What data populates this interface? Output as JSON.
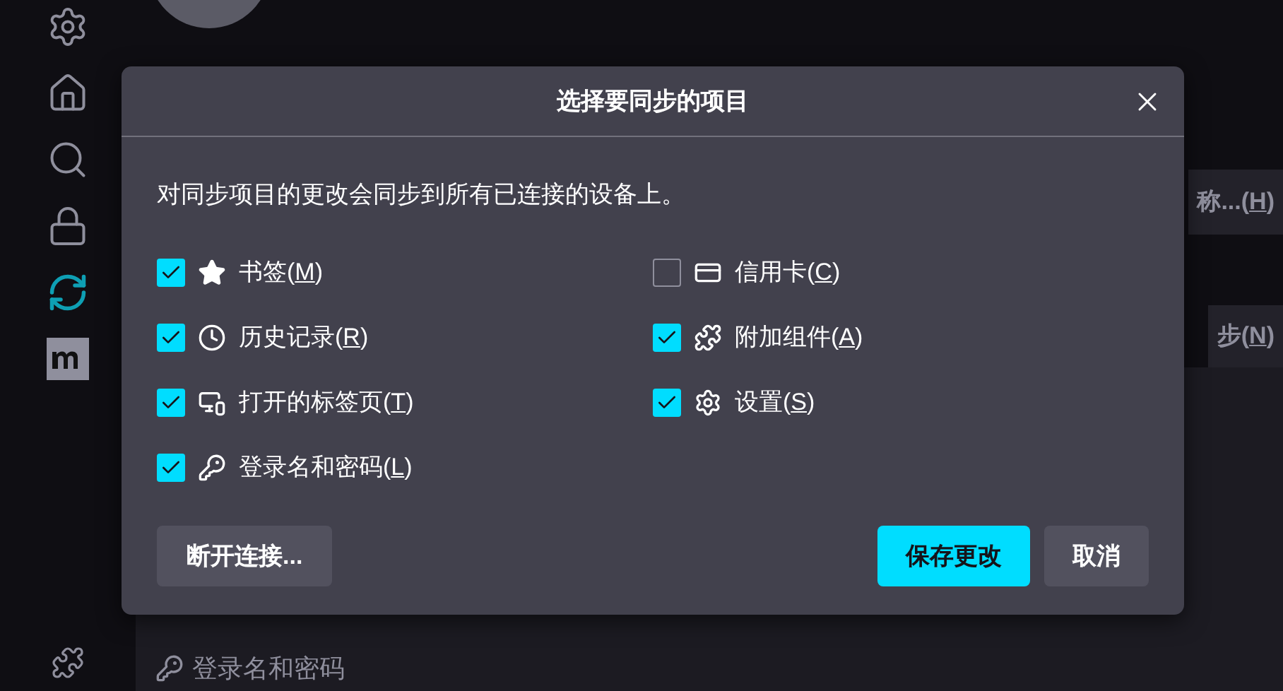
{
  "sidebar": {
    "items": [
      {
        "kind": "gear",
        "selected": false
      },
      {
        "kind": "home",
        "selected": false
      },
      {
        "kind": "search",
        "selected": false
      },
      {
        "kind": "lock",
        "selected": false
      },
      {
        "kind": "sync",
        "selected": true
      },
      {
        "kind": "logo",
        "selected": false
      }
    ],
    "bottom_item": {
      "kind": "puzzle",
      "selected": false
    }
  },
  "background": {
    "buttons": [
      {
        "before": "称...(",
        "key": "H",
        "after": ")"
      },
      {
        "before": "步(",
        "key": "N",
        "after": ")"
      }
    ],
    "footer_item": "登录名和密码"
  },
  "dialog": {
    "title": "选择要同步的项目",
    "description": "对同步项目的更改会同步到所有已连接的设备上。",
    "items": [
      {
        "kind": "bookmarks",
        "before": "书签(",
        "key": "M",
        "after": ")",
        "checked": true
      },
      {
        "kind": "cards",
        "before": "信用卡(",
        "key": "C",
        "after": ")",
        "checked": false
      },
      {
        "kind": "history",
        "before": "历史记录(",
        "key": "R",
        "after": ")",
        "checked": true
      },
      {
        "kind": "addons",
        "before": "附加组件(",
        "key": "A",
        "after": ")",
        "checked": true
      },
      {
        "kind": "tabs",
        "before": "打开的标签页(",
        "key": "T",
        "after": ")",
        "checked": true
      },
      {
        "kind": "settings",
        "before": "设置(",
        "key": "S",
        "after": ")",
        "checked": true
      },
      {
        "kind": "logins",
        "before": "登录名和密码(",
        "key": "L",
        "after": ")",
        "checked": true
      }
    ],
    "disconnect": "断开连接...",
    "save": "保存更改",
    "cancel": "取消"
  }
}
